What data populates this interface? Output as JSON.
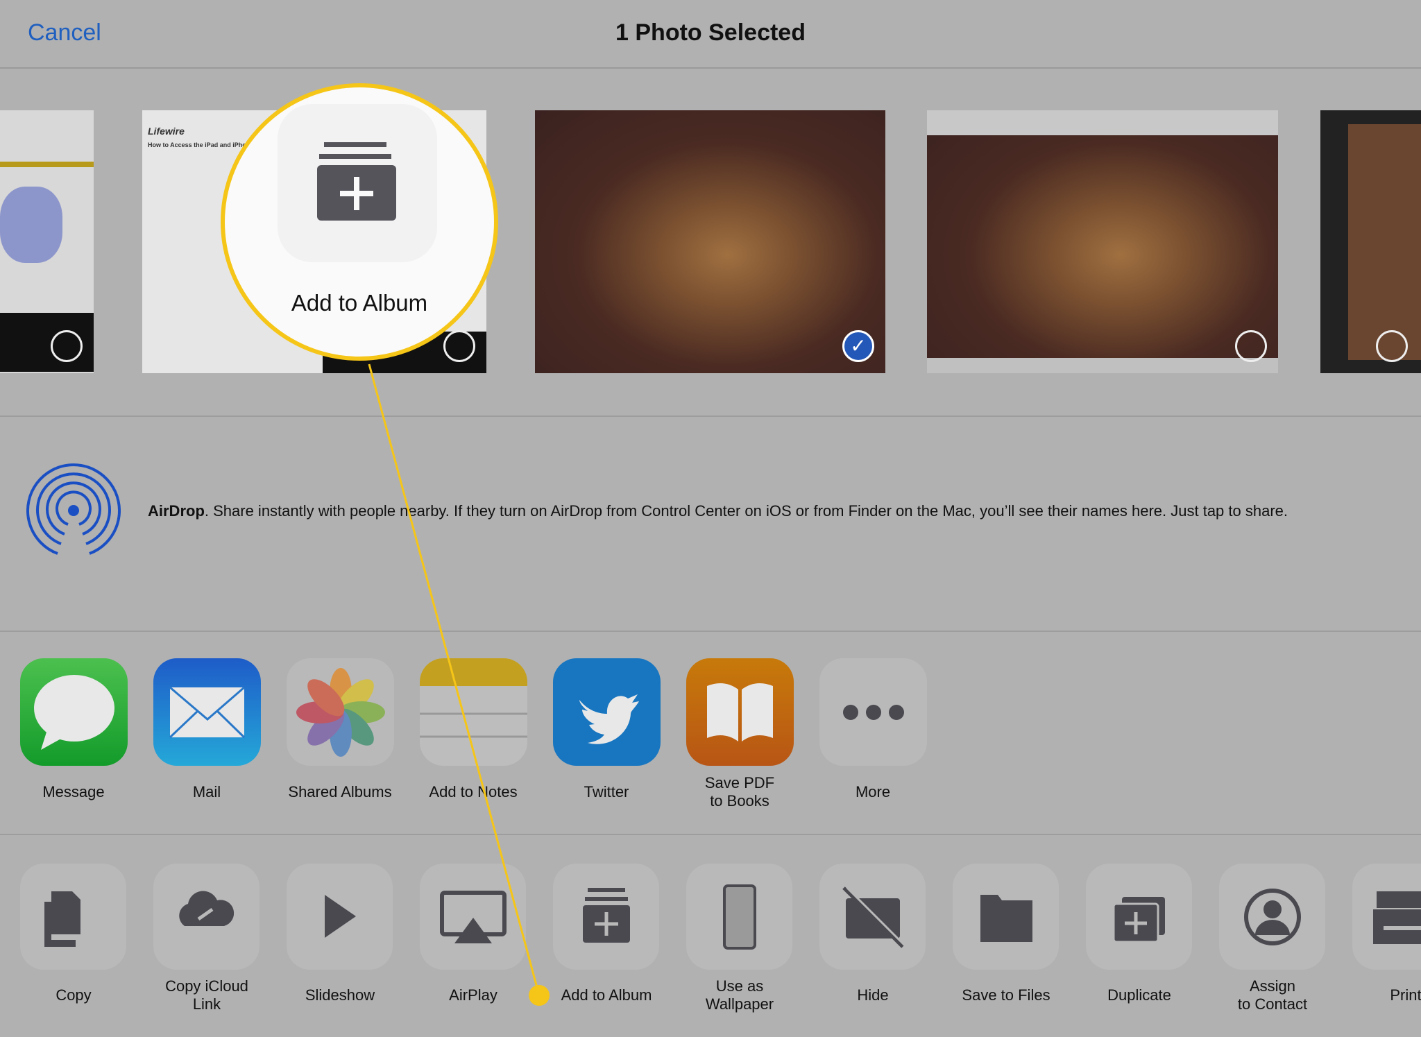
{
  "header": {
    "cancel": "Cancel",
    "title": "1 Photo Selected"
  },
  "photos": [
    {
      "selected": false
    },
    {
      "selected": false,
      "site": "Lifewire",
      "heading": "How to Access the iPad and iPhone Calendar"
    },
    {
      "selected": true
    },
    {
      "selected": false
    },
    {
      "selected": false
    }
  ],
  "airdrop": {
    "name": "AirDrop",
    "text": ". Share instantly with people nearby. If they turn on AirDrop from Control Center on iOS or from Finder on the Mac, you’ll see their names here. Just tap to share."
  },
  "apps": [
    {
      "label": "Message",
      "icon": "message-icon"
    },
    {
      "label": "Mail",
      "icon": "mail-icon"
    },
    {
      "label": "Shared Albums",
      "icon": "photos-icon"
    },
    {
      "label": "Add to Notes",
      "icon": "notes-icon"
    },
    {
      "label": "Twitter",
      "icon": "twitter-icon"
    },
    {
      "label": "Save PDF\nto Books",
      "icon": "books-icon"
    },
    {
      "label": "More",
      "icon": "more-icon"
    }
  ],
  "actions": [
    {
      "label": "Copy"
    },
    {
      "label": "Copy iCloud\nLink"
    },
    {
      "label": "Slideshow"
    },
    {
      "label": "AirPlay"
    },
    {
      "label": "Add to Album"
    },
    {
      "label": "Use as\nWallpaper"
    },
    {
      "label": "Hide"
    },
    {
      "label": "Save to Files"
    },
    {
      "label": "Duplicate"
    },
    {
      "label": "Assign\nto Contact"
    },
    {
      "label": "Print"
    }
  ],
  "callout": {
    "label": "Add to Album",
    "color": "#f5c518"
  },
  "colors": {
    "accent": "#1f5fbf",
    "background": "#b1b1b1",
    "glyph": "#4a4950"
  }
}
